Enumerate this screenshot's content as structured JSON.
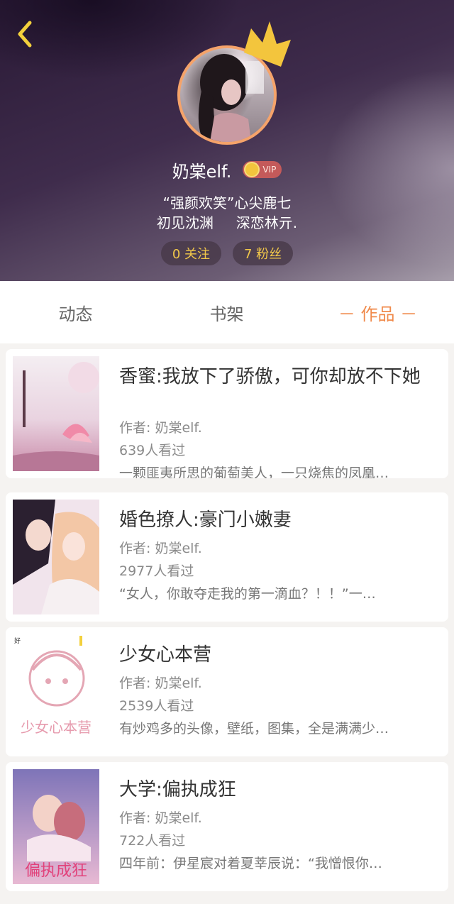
{
  "profile": {
    "username": "奶棠elf.",
    "vip_label": "VIP",
    "bio_line1": "“强颜欢笑”心尖鹿七",
    "bio_line2": "初见沈渊     深恋林亓.",
    "following": "0 关注",
    "followers": "7 粉丝"
  },
  "tabs": [
    {
      "label": "动态"
    },
    {
      "label": "书架"
    },
    {
      "label": "－ 作品 －"
    }
  ],
  "books": [
    {
      "title": "香蜜:我放下了骄傲，可你却放不下她",
      "author": "作者: 奶棠elf.",
      "views": "639人看过",
      "desc": "一颗匪夷所思的葡萄美人，一只烧焦的凤凰…"
    },
    {
      "title": "婚色撩人:豪门小嫩妻",
      "author": "作者: 奶棠elf.",
      "views": "2977人看过",
      "desc": "“女人，你敢夺走我的第一滴血？！！”一…"
    },
    {
      "title": "少女心本营",
      "author": "作者: 奶棠elf.",
      "views": "2539人看过",
      "desc": "有炒鸡多的头像，壁纸，图集，全是满满少…"
    },
    {
      "title": "大学:偏执成狂",
      "author": "作者: 奶棠elf.",
      "views": "722人看过",
      "desc": "四年前：伊星宸对着夏莘辰说：“我憎恨你…"
    }
  ],
  "cover_texts": {
    "cover3_small": "好",
    "cover3_big": "少女心本营",
    "cover4_big": "偏执成狂"
  },
  "colors": {
    "accent": "#f08a4b",
    "stat_text": "#f1c74a"
  }
}
